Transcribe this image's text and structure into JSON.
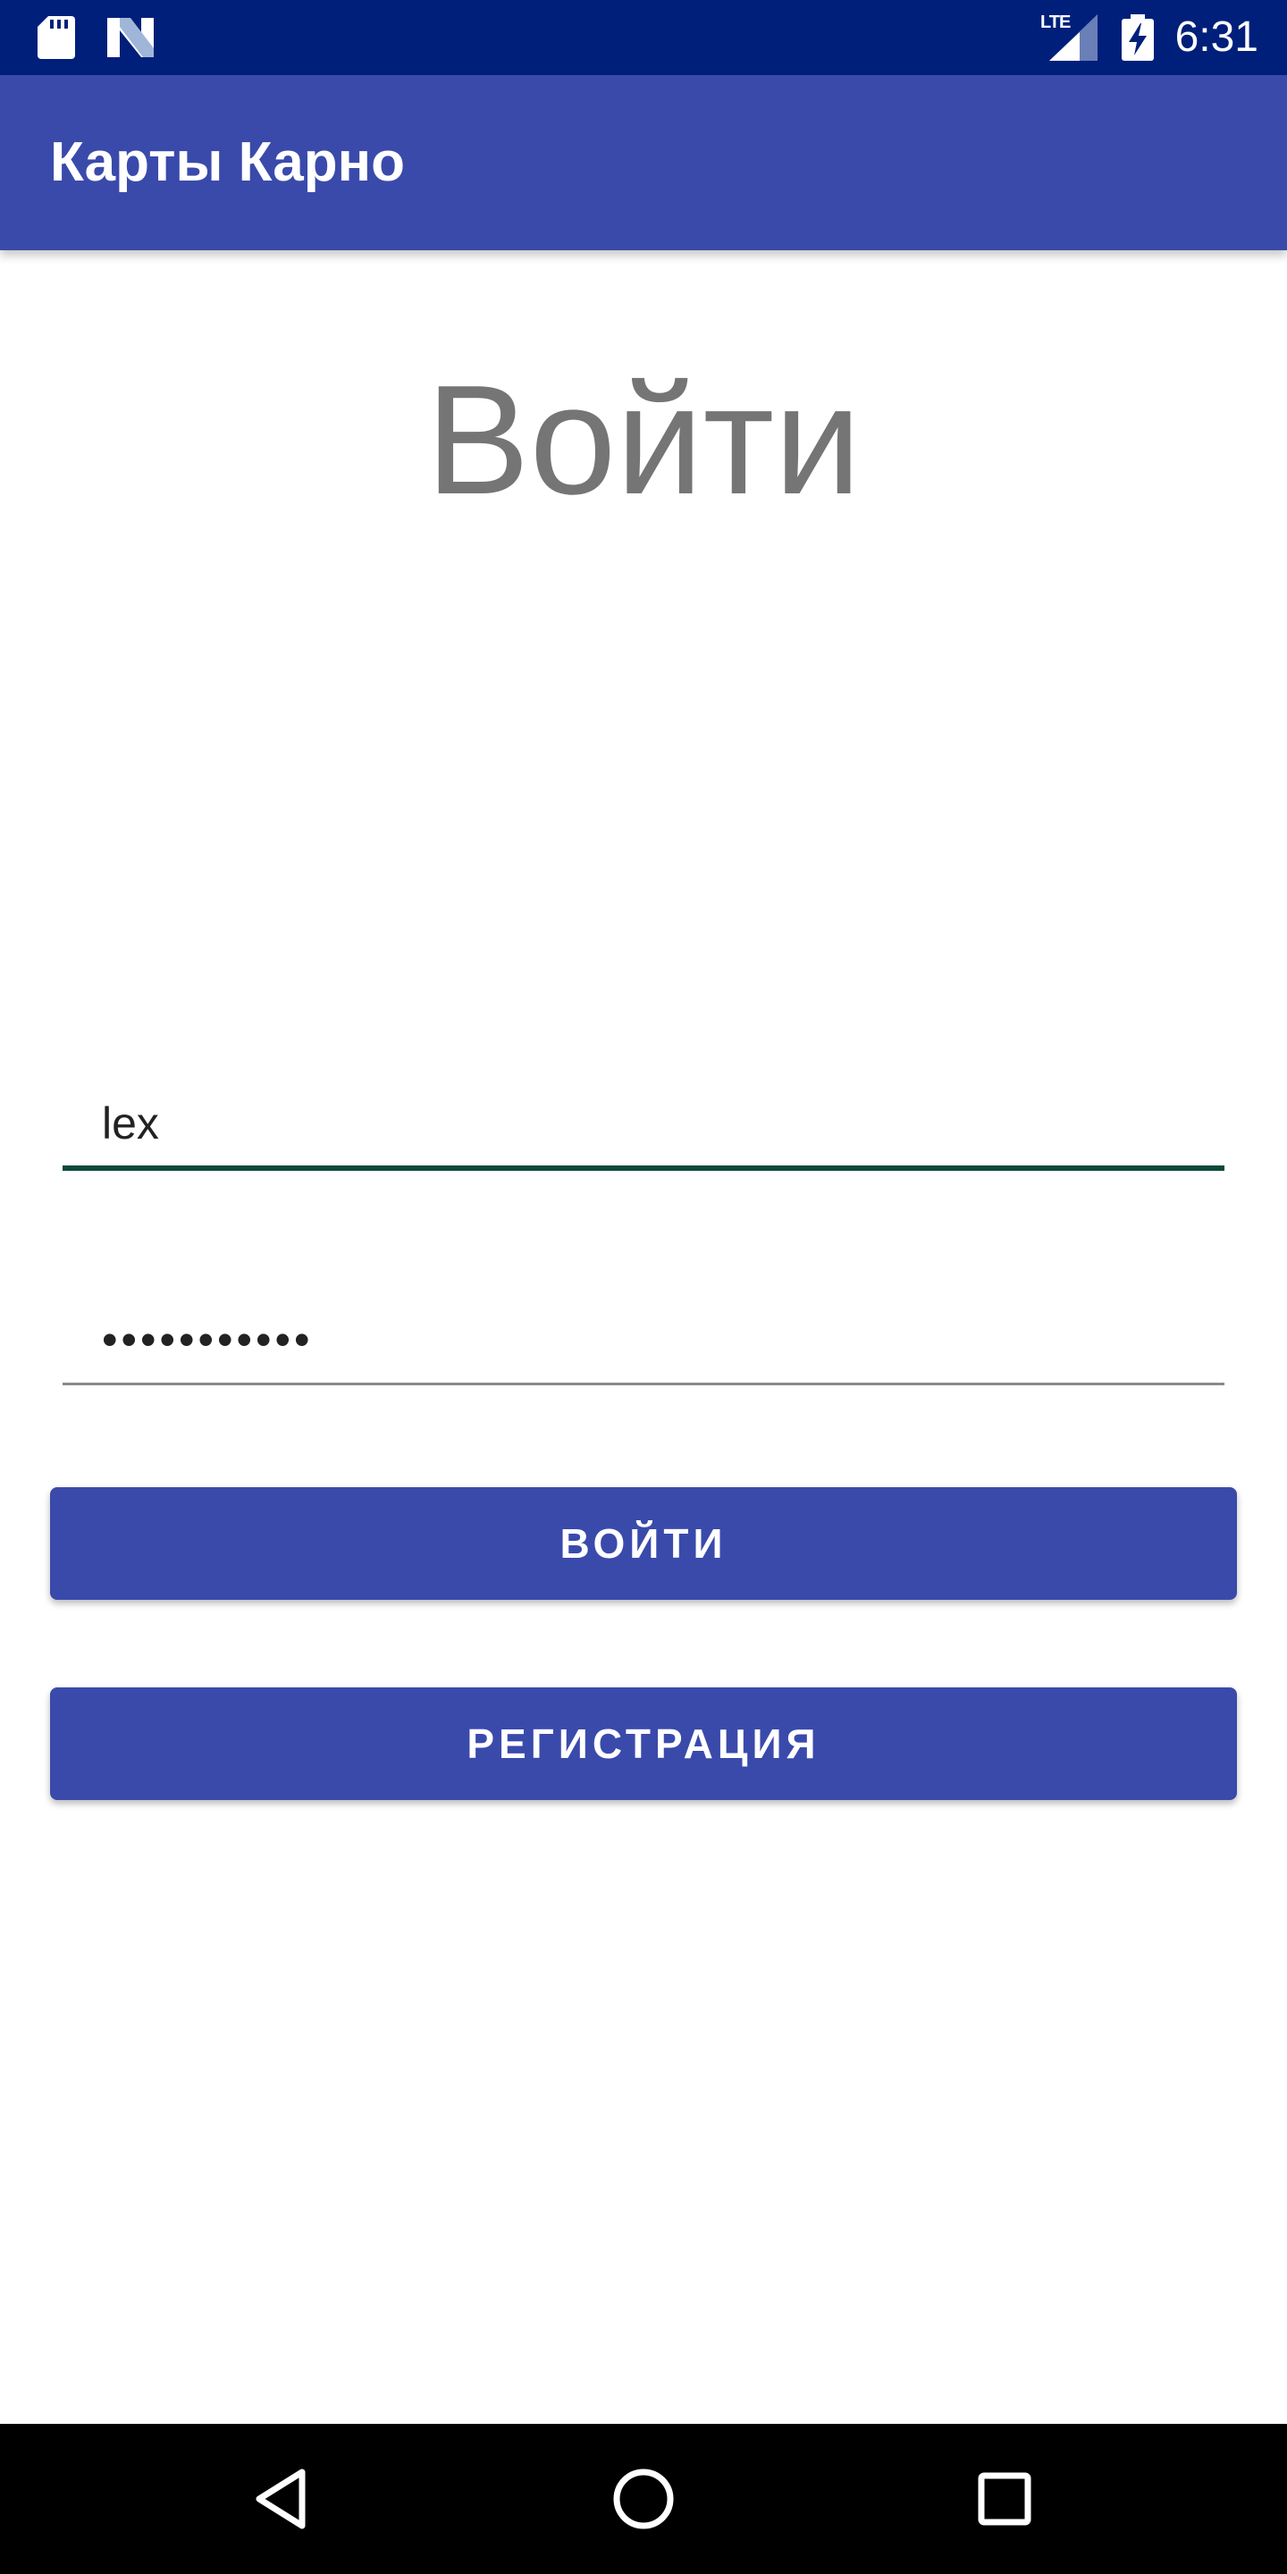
{
  "status_bar": {
    "time": "6:31",
    "network_label": "LTE",
    "icons": [
      "sd-card-icon",
      "n-notification-icon",
      "lte-signal-icon",
      "battery-charging-icon"
    ]
  },
  "app_bar": {
    "title": "Карты Карно",
    "color": "#3a4aab"
  },
  "login": {
    "heading": "Войти",
    "username_value": "lex",
    "password_value": "•••••••••••",
    "login_button": "ВОЙТИ",
    "register_button": "РЕГИСТРАЦИЯ"
  },
  "nav_bar": {
    "icons": [
      "back-icon",
      "home-icon",
      "recent-apps-icon"
    ]
  },
  "colors": {
    "status_bar": "#001f7a",
    "primary": "#3a4aab",
    "focused_underline": "#0c4a3c",
    "heading_text": "#757575"
  }
}
